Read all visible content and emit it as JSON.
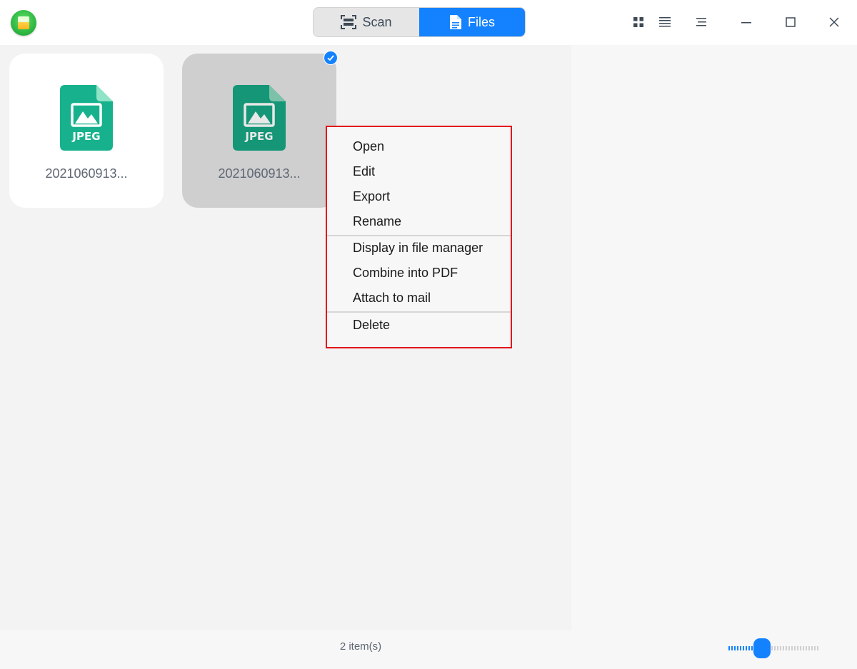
{
  "app": {
    "logo_icon": "scanner-app-icon"
  },
  "mode_switch": {
    "scan_label": "Scan",
    "files_label": "Files",
    "active": "files"
  },
  "toolbar": {
    "icons": [
      "grid-view-icon",
      "list-view-icon",
      "menu-icon",
      "minimize-icon",
      "maximize-icon",
      "close-icon"
    ]
  },
  "files": [
    {
      "name": "2021060913...",
      "type": "JPEG",
      "selected": false
    },
    {
      "name": "2021060913...",
      "type": "JPEG",
      "selected": true
    }
  ],
  "context_menu": {
    "groups": [
      [
        "Open",
        "Edit",
        "Export",
        "Rename"
      ],
      [
        "Display in file manager",
        "Combine into PDF",
        "Attach to mail"
      ],
      [
        "Delete"
      ]
    ]
  },
  "status": {
    "item_count": "2 item(s)"
  },
  "zoom": {
    "level_fraction": 0.35
  },
  "colors": {
    "accent": "#1482ff",
    "highlight_border": "#e3141b",
    "jpeg_icon": "#17b28d"
  }
}
